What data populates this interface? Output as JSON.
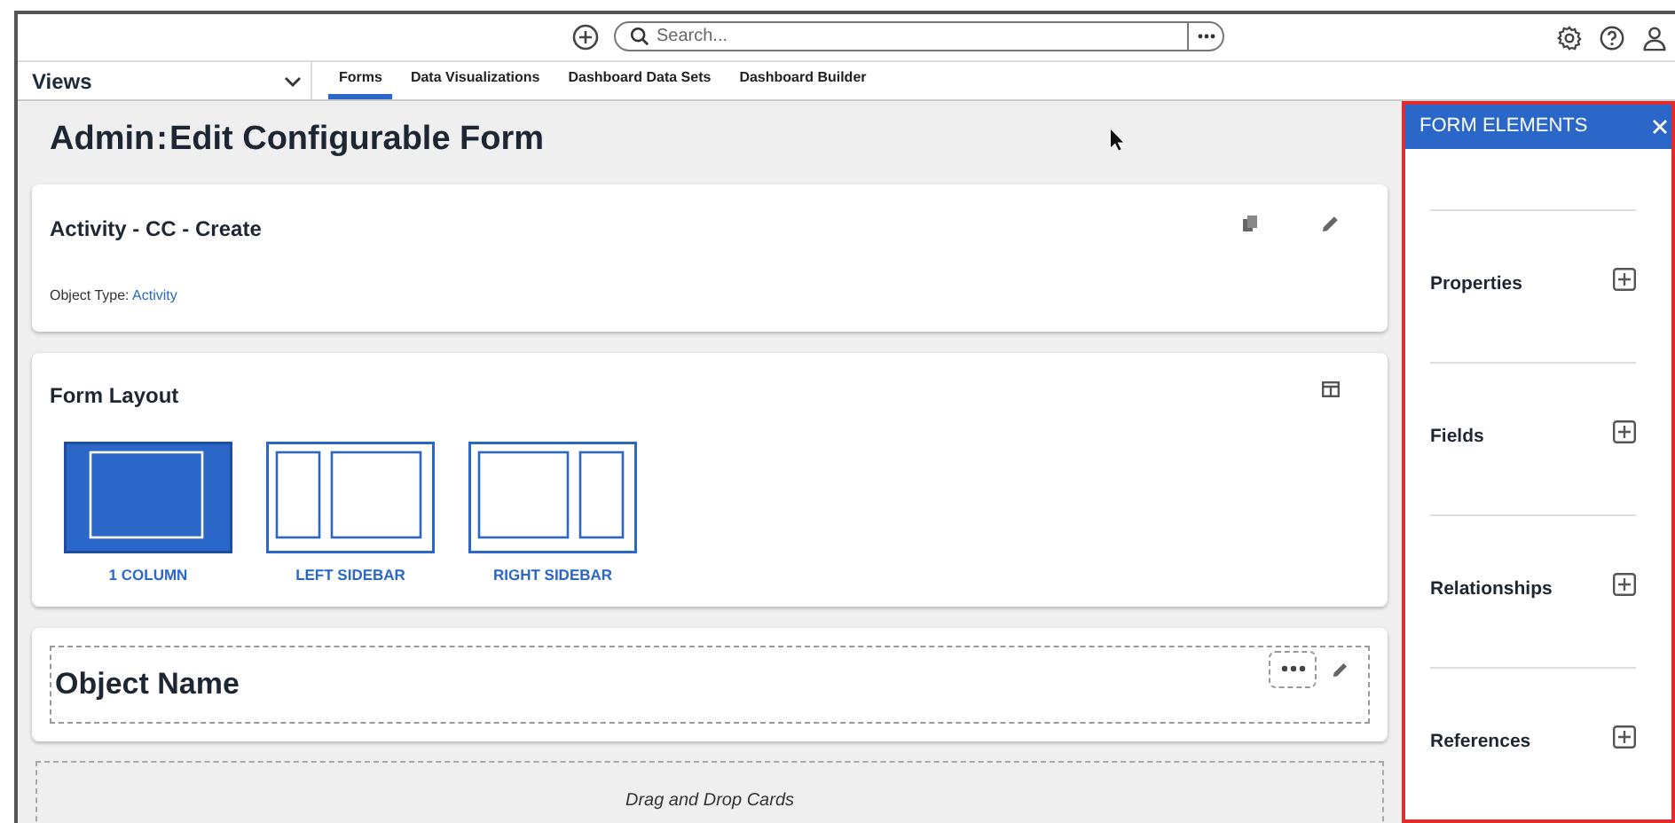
{
  "top_bar": {
    "search": {
      "placeholder": "Search..."
    }
  },
  "views": {
    "label": "Views"
  },
  "tabs": [
    {
      "label": "Forms",
      "selected": true
    },
    {
      "label": "Data Visualizations",
      "selected": false
    },
    {
      "label": "Dashboard Data Sets",
      "selected": false
    },
    {
      "label": "Dashboard Builder",
      "selected": false
    }
  ],
  "page_title": {
    "prefix": "Admin",
    "separator": ":",
    "title": "Edit Configurable Form"
  },
  "form_card": {
    "title": "Activity - CC - Create",
    "object_type_label": "Object Type:",
    "object_type": "Activity"
  },
  "layout_card": {
    "title": "Form Layout",
    "options": [
      {
        "kind": "one",
        "label": "1 COLUMN",
        "selected": true
      },
      {
        "kind": "left",
        "label": "LEFT SIDEBAR",
        "selected": false
      },
      {
        "kind": "right",
        "label": "RIGHT SIDEBAR",
        "selected": false
      }
    ]
  },
  "object_card": {
    "title": "Object Name"
  },
  "drop_zone": {
    "text": "Drag and Drop Cards"
  },
  "form_elements": {
    "title": "FORM ELEMENTS",
    "sections": [
      {
        "label": "Properties"
      },
      {
        "label": "Fields"
      },
      {
        "label": "Relationships"
      },
      {
        "label": "References"
      }
    ]
  }
}
